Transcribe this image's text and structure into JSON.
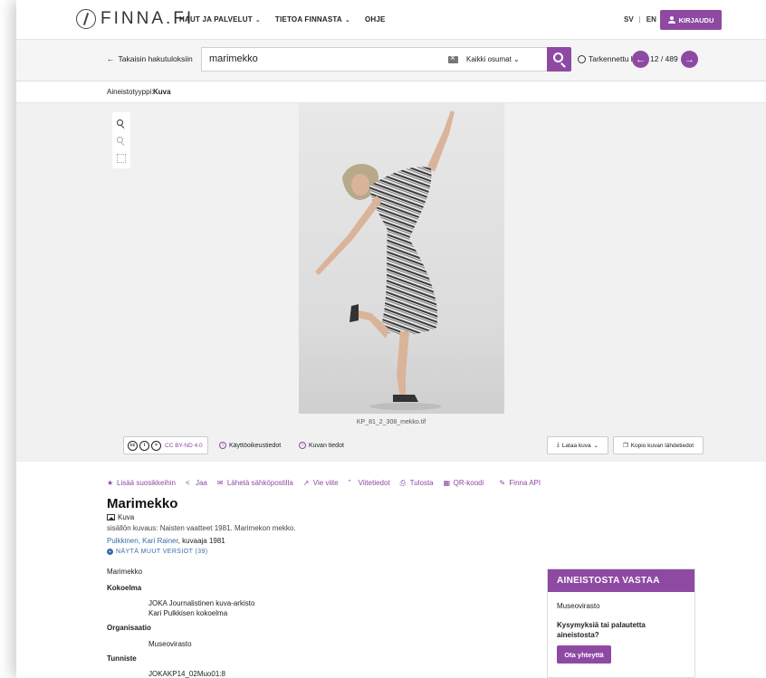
{
  "navbar": {
    "logo_text": "FINNA.FI",
    "links": [
      {
        "label": "HAUT JA PALVELUT",
        "caret": "⌄"
      },
      {
        "label": "TIETOA FINNASTA",
        "caret": "⌄"
      },
      {
        "label": "OHJE",
        "caret": ""
      }
    ],
    "lang_sv": "SV",
    "lang_sep": "|",
    "lang_en": "EN",
    "login_label": "KIRJAUDU"
  },
  "search": {
    "back_label": "Takaisin hakutuloksiin",
    "query": "marimekko",
    "scope": "Kaikki osumat",
    "advanced_label": "Tarkennettu haku",
    "counter": "12 / 489"
  },
  "filter": {
    "label": "Aineistotyyppi:",
    "value": "Kuva"
  },
  "viewer": {
    "filename": "KP_81_2_308_mekko.tif",
    "license": "CC BY-ND 4.0",
    "usage_rights": "Käyttöoikeustiedot",
    "image_info": "Kuvan tiedot",
    "download": "Lataa kuva",
    "copy_source": "Kopio kuvan lähdetiedot"
  },
  "actions": [
    {
      "icon": "star-icon",
      "label": "Lisää suosikkeihin"
    },
    {
      "icon": "share-icon",
      "label": "Jaa"
    },
    {
      "icon": "mail-icon",
      "label": "Lähetä sähköpostilla"
    },
    {
      "icon": "export-icon",
      "label": "Vie viite"
    },
    {
      "icon": "quote-icon",
      "label": "Viitetiedot"
    },
    {
      "icon": "print-icon",
      "label": "Tulosta"
    },
    {
      "icon": "qr-icon",
      "label": "QR-koodi"
    },
    {
      "icon": "api-icon",
      "label": "Finna API"
    }
  ],
  "record": {
    "title": "Marimekko",
    "format": "Kuva",
    "description": "sisällön kuvaus: Naisten vaatteet 1981. Marimekon mekko.",
    "author_link": "Pulkkinen, Kari Rainer",
    "author_role": ", kuvaaja 1981",
    "versions": "NÄYTÄ MUUT VERSIOT (39)",
    "subject": "Marimekko",
    "collection_heading": "Kokoelma",
    "collection_1": "JOKA Journalistinen kuva-arkisto",
    "collection_2": "Kari Pulkkisen kokoelma",
    "organisation_heading": "Organisaatio",
    "organisation": "Museovirasto",
    "identifier_heading": "Tunniste",
    "identifier": "JOKAKP14_02Muo01:8"
  },
  "side": {
    "heading": "AINEISTOSTA VASTAA",
    "org": "Museovirasto",
    "question": "Kysymyksiä tai palautetta aineistosta?",
    "contact": "Ota yhteyttä"
  },
  "colors": {
    "accent": "#8e4aa3",
    "link": "#3a6ca8"
  }
}
